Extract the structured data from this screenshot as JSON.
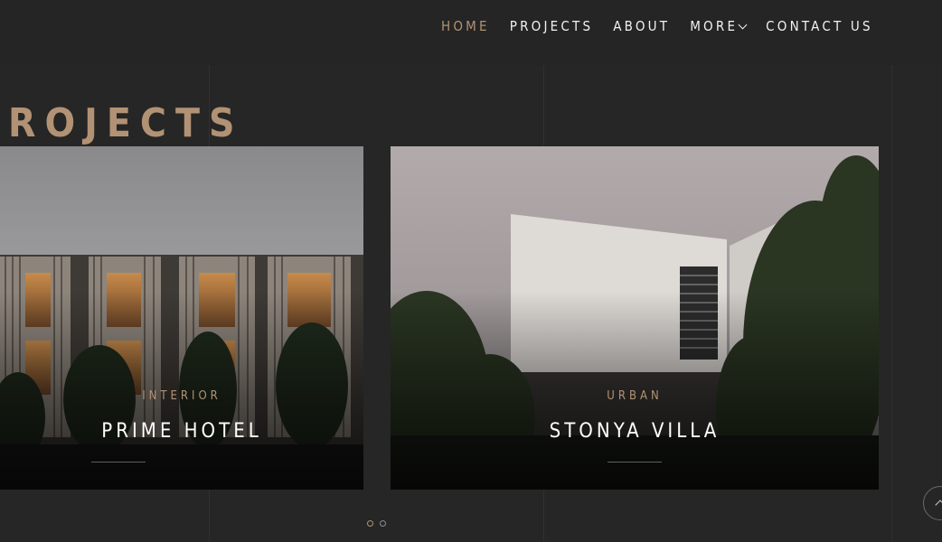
{
  "nav": {
    "items": [
      {
        "label": "HOME",
        "active": true
      },
      {
        "label": "PROJECTS",
        "active": false
      },
      {
        "label": "ABOUT",
        "active": false
      },
      {
        "label": "MORE",
        "active": false,
        "dropdown": true
      },
      {
        "label": "CONTACT US",
        "active": false
      }
    ]
  },
  "page": {
    "title": "ROJECTS"
  },
  "projects": [
    {
      "category": "INTERIOR",
      "name": "PRIME HOTEL"
    },
    {
      "category": "URBAN",
      "name": "STONYA VILLA"
    }
  ],
  "slider": {
    "dots": 2,
    "active_index": 0
  },
  "colors": {
    "background": "#262626",
    "accent": "#b29274",
    "text": "#f2f2f2"
  },
  "icons": {
    "more_dropdown": "chevron-down-icon",
    "scroll_top": "arrow-up-icon"
  }
}
